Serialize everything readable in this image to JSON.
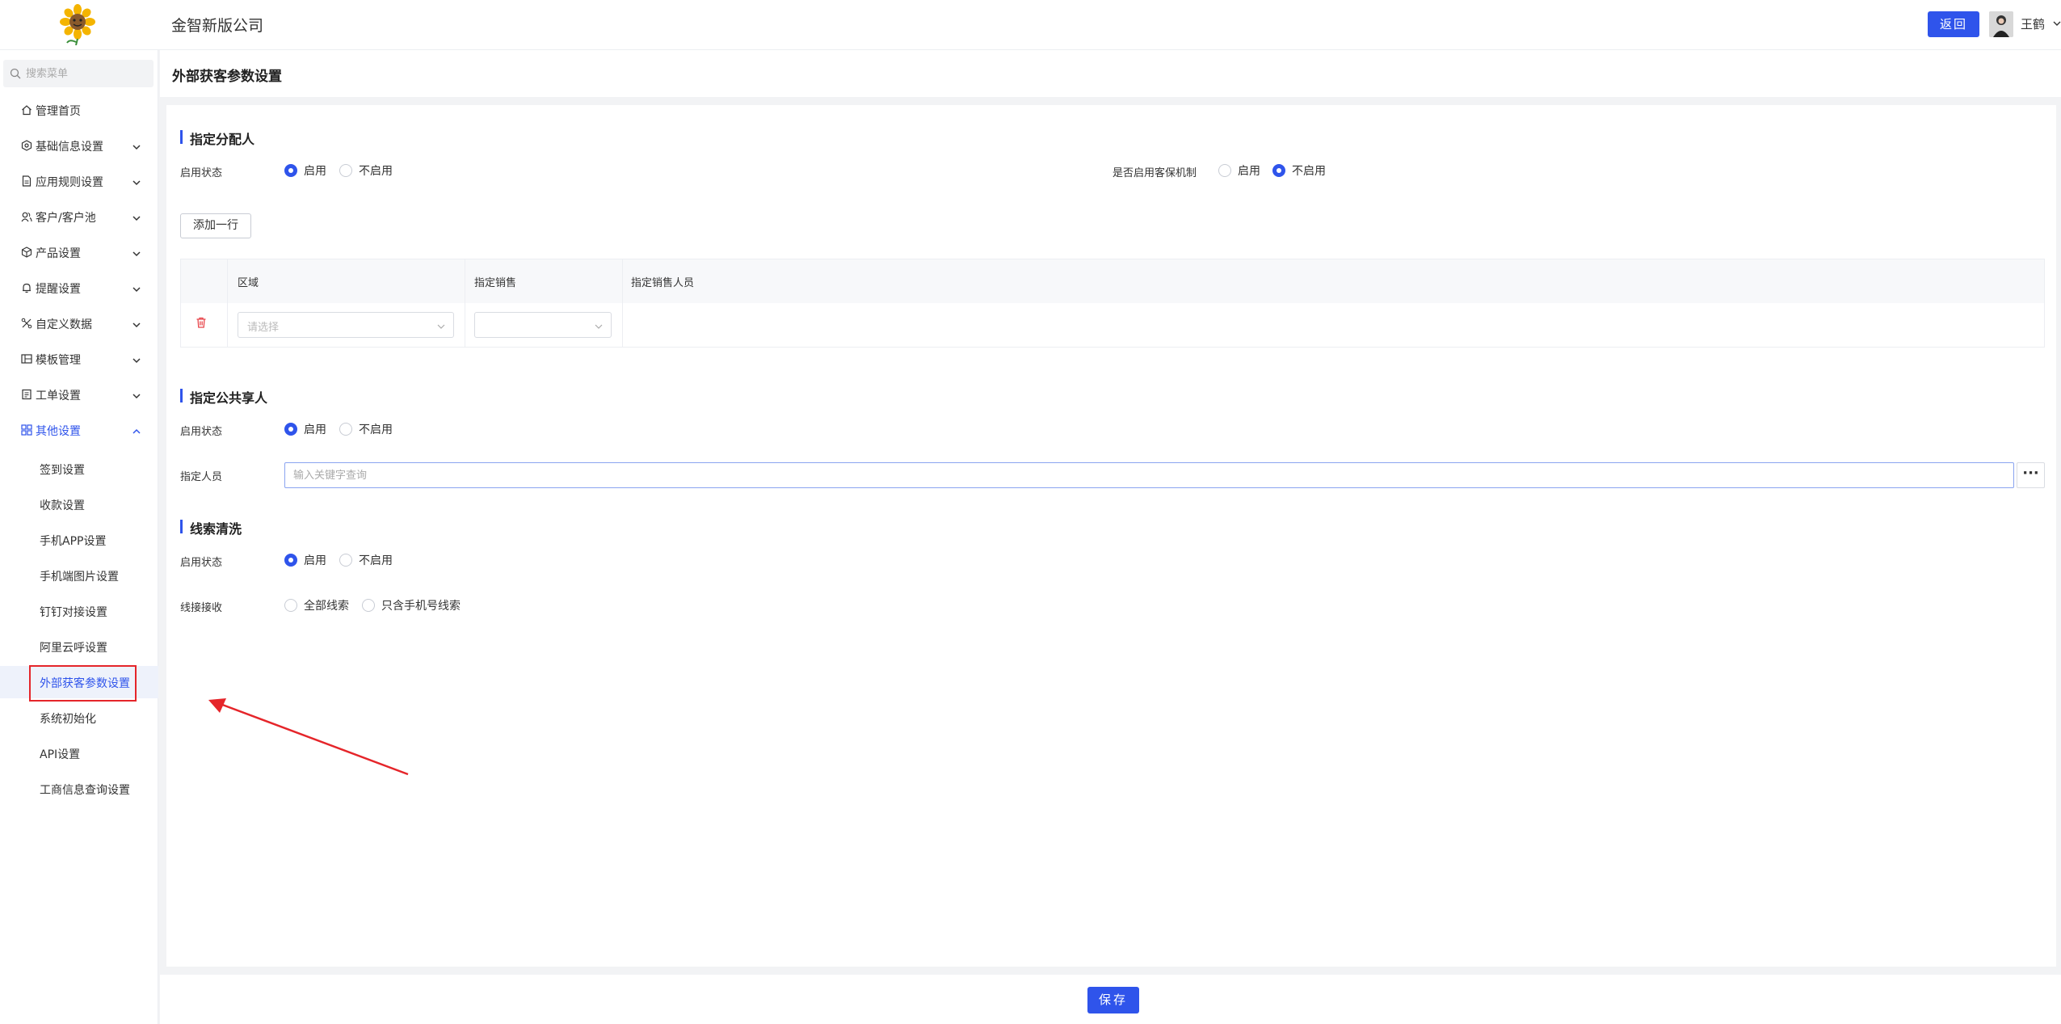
{
  "header": {
    "company": "金智新版公司",
    "back_label": "返回",
    "username": "王鹤"
  },
  "sidebar": {
    "search_placeholder": "搜索菜单",
    "items": [
      {
        "label": "管理首页",
        "icon": "home-icon"
      },
      {
        "label": "基础信息设置",
        "icon": "settings-hex-icon"
      },
      {
        "label": "应用规则设置",
        "icon": "document-icon"
      },
      {
        "label": "客户/客户池",
        "icon": "customers-icon"
      },
      {
        "label": "产品设置",
        "icon": "cube-icon"
      },
      {
        "label": "提醒设置",
        "icon": "bell-icon"
      },
      {
        "label": "自定义数据",
        "icon": "tools-icon"
      },
      {
        "label": "模板管理",
        "icon": "template-icon"
      },
      {
        "label": "工单设置",
        "icon": "ticket-icon"
      },
      {
        "label": "其他设置",
        "icon": "grid-icon"
      }
    ],
    "sub_items": [
      "签到设置",
      "收款设置",
      "手机APP设置",
      "手机端图片设置",
      "钉钉对接设置",
      "阿里云呼设置",
      "外部获客参数设置",
      "系统初始化",
      "API设置",
      "工商信息查询设置"
    ],
    "active_sub_item": "外部获客参数设置"
  },
  "page": {
    "title": "外部获客参数设置"
  },
  "section_assign": {
    "title": "指定分配人",
    "status_label": "启用状态",
    "enable": "启用",
    "disable": "不启用",
    "status_value": "启用",
    "guarantee_label": "是否启用客保机制",
    "guarantee_enable": "启用",
    "guarantee_disable": "不启用",
    "guarantee_value": "不启用",
    "add_row_label": "添加一行",
    "table": {
      "columns": [
        "区域",
        "指定销售",
        "指定销售人员"
      ],
      "rows": [
        {
          "region_placeholder": "请选择",
          "sales_value": "",
          "sales_person": ""
        }
      ]
    }
  },
  "section_public": {
    "title": "指定公共享人",
    "status_label": "启用状态",
    "enable": "启用",
    "disable": "不启用",
    "status_value": "启用",
    "person_label": "指定人员",
    "person_placeholder": "输入关键字查询",
    "more_label": "···"
  },
  "section_clean": {
    "title": "线索清洗",
    "status_label": "启用状态",
    "enable": "启用",
    "disable": "不启用",
    "status_value": "启用",
    "receive_label": "线接接收",
    "receive_all": "全部线索",
    "receive_phone": "只含手机号线索",
    "receive_value": ""
  },
  "footer": {
    "save_label": "保存"
  },
  "colors": {
    "primary": "#2f54eb",
    "annotation": "#e5252a",
    "delete": "#e8454a"
  }
}
